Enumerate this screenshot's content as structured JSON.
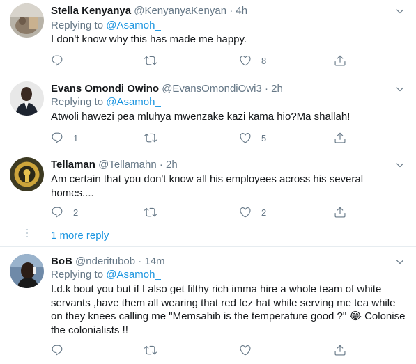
{
  "replying_prefix": "Replying to",
  "tweets": [
    {
      "name": "Stella Kenyanya",
      "handle": "@KenyanyaKenyan",
      "dot": "·",
      "time": "4h",
      "reply_to": "@Asamoh_",
      "text": "I don't know why this has made me happy.",
      "replies": "",
      "retweets": "",
      "likes": "8"
    },
    {
      "name": "Evans Omondi Owino",
      "handle": "@EvansOmondiOwi3",
      "dot": "·",
      "time": "2h",
      "reply_to": "@Asamoh_",
      "text": "Atwoli hawezi pea mluhya mwenzake kazi kama hio?Ma shallah!",
      "replies": "1",
      "retweets": "",
      "likes": "5"
    },
    {
      "name": "Tellaman",
      "handle": "@Tellamahn",
      "dot": "·",
      "time": "2h",
      "reply_to": "",
      "text": "Am certain that you don't know all his employees across his several homes....",
      "replies": "2",
      "retweets": "",
      "likes": "2"
    },
    {
      "name": "BoB",
      "handle": "@nderitubob",
      "dot": "·",
      "time": "14m",
      "reply_to": "@Asamoh_",
      "text": "I.d.k bout you but if I also get filthy rich imma  hire a whole team of white servants ,have them all wearing that red fez hat while serving me tea while on they knees calling me \"Memsahib is the temperature good ?\" 😂 Colonise the colonialists !!",
      "replies": "",
      "retweets": "",
      "likes": ""
    }
  ],
  "more_replies": "1 more reply",
  "icons": {
    "reply": "reply-icon",
    "retweet": "retweet-icon",
    "like": "heart-icon",
    "share": "share-icon",
    "menu": "chevron-down-icon"
  },
  "colors": {
    "link": "#1b95e0",
    "secondary": "#657786",
    "divider": "#e6ecf0"
  }
}
